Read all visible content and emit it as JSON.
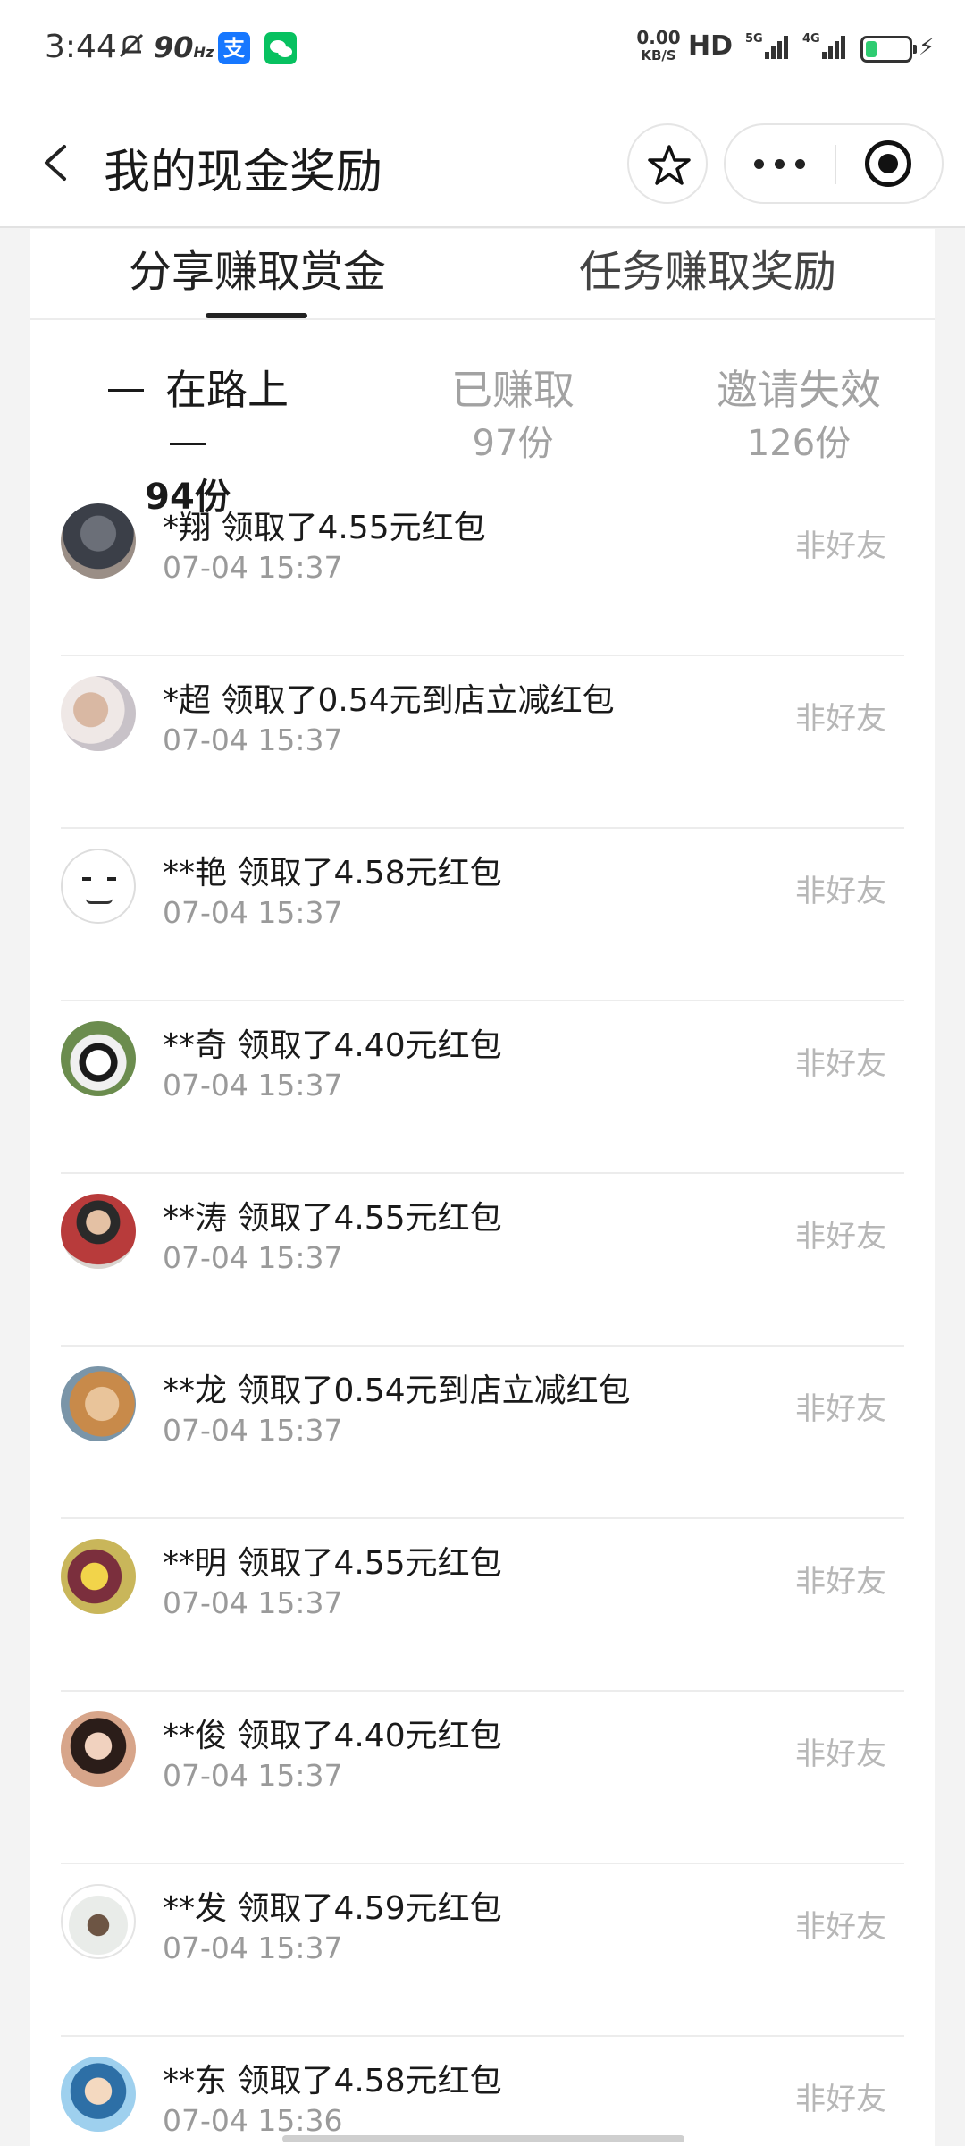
{
  "status_bar": {
    "time": "3:44",
    "refresh_rate": "90",
    "refresh_unit": "Hz",
    "alipay_glyph": "支",
    "net_speed": "0.00",
    "net_speed_unit": "KB/S",
    "hd_label": "HD",
    "network_1": "5G",
    "network_2": "4G",
    "battery_percent": 25,
    "battery_color": "#2ecc71"
  },
  "nav": {
    "title": "我的现金奖励",
    "icons": [
      "back-arrow-icon",
      "star-icon",
      "more-icon",
      "close-target-icon"
    ]
  },
  "main_tabs": [
    {
      "label": "分享赚取赏金",
      "active": true
    },
    {
      "label": "任务赚取奖励",
      "active": false
    }
  ],
  "sub_tabs": [
    {
      "label": "在路上",
      "count": "94份",
      "active": true
    },
    {
      "label": "已赚取",
      "count": "97份",
      "active": false
    },
    {
      "label": "邀请失效",
      "count": "126份",
      "active": false
    }
  ],
  "records": [
    {
      "text": "*翔 领取了4.55元红包",
      "time": "07-04 15:37",
      "status": "非好友"
    },
    {
      "text": "*超 领取了0.54元到店立减红包",
      "time": "07-04 15:37",
      "status": "非好友"
    },
    {
      "text": "**艳 领取了4.58元红包",
      "time": "07-04 15:37",
      "status": "非好友"
    },
    {
      "text": "**奇 领取了4.40元红包",
      "time": "07-04 15:37",
      "status": "非好友"
    },
    {
      "text": "**涛 领取了4.55元红包",
      "time": "07-04 15:37",
      "status": "非好友"
    },
    {
      "text": "**龙 领取了0.54元到店立减红包",
      "time": "07-04 15:37",
      "status": "非好友"
    },
    {
      "text": "**明 领取了4.55元红包",
      "time": "07-04 15:37",
      "status": "非好友"
    },
    {
      "text": "**俊 领取了4.40元红包",
      "time": "07-04 15:37",
      "status": "非好友"
    },
    {
      "text": "**发 领取了4.59元红包",
      "time": "07-04 15:37",
      "status": "非好友"
    },
    {
      "text": "**东 领取了4.58元红包",
      "time": "07-04 15:36",
      "status": "非好友"
    }
  ],
  "colors": {
    "background": "#f3f3f3",
    "primary_text": "#1a1a1a",
    "secondary_text": "#9a9a9a",
    "status_text": "#b7b7b7"
  }
}
